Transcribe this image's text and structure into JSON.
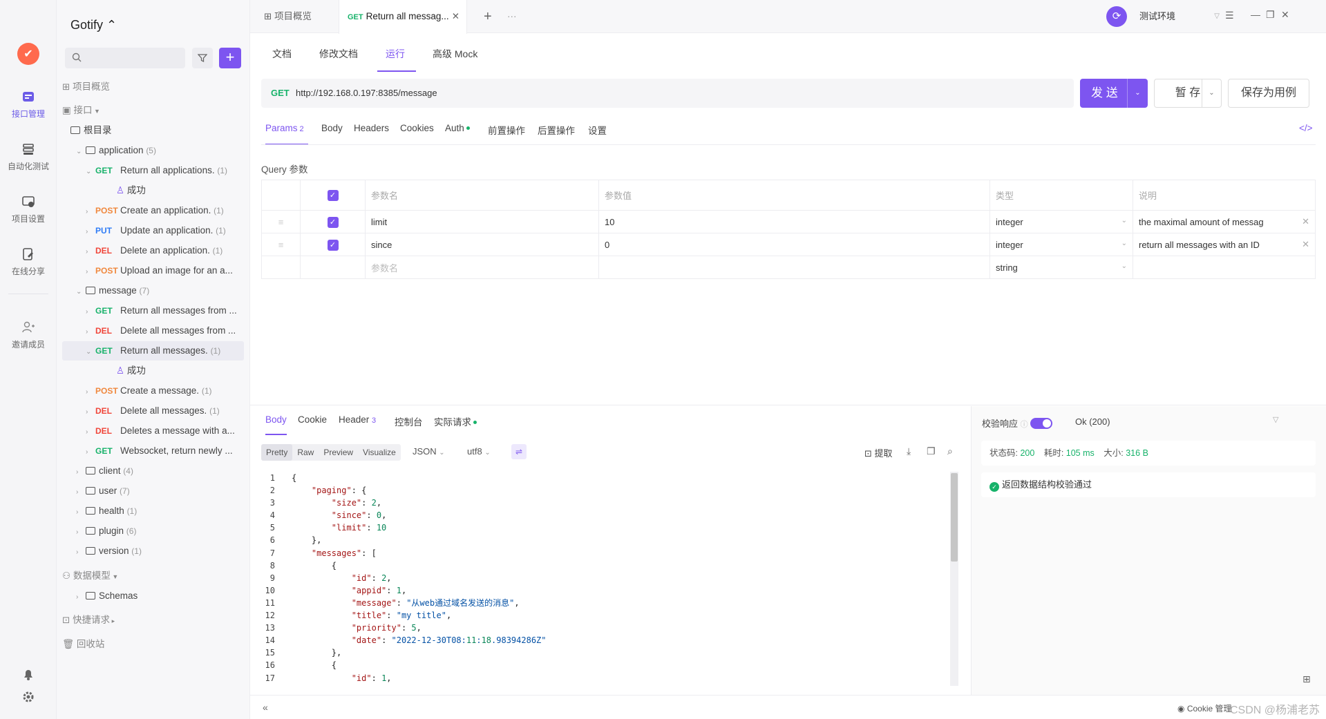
{
  "app": {
    "project": "Gotify ⌃"
  },
  "rail": {
    "items": [
      {
        "label": "接口管理"
      },
      {
        "label": "自动化测试"
      },
      {
        "label": "项目设置"
      },
      {
        "label": "在线分享"
      },
      {
        "label": "邀请成员"
      }
    ]
  },
  "tree": {
    "overview": "项目概览",
    "api_root": "接口",
    "root_dir": "根目录",
    "application": {
      "name": "application",
      "count": "(5)"
    },
    "rows": [
      {
        "method": "GET",
        "label": "Return all applications.",
        "count": "(1)"
      },
      {
        "method": "",
        "label": "成功",
        "count": ""
      },
      {
        "method": "POST",
        "label": "Create an application.",
        "count": "(1)"
      },
      {
        "method": "PUT",
        "label": "Update an application.",
        "count": "(1)"
      },
      {
        "method": "DEL",
        "label": "Delete an application.",
        "count": "(1)"
      },
      {
        "method": "POST",
        "label": "Upload an image for an a...",
        "count": ""
      }
    ],
    "message": {
      "name": "message",
      "count": "(7)"
    },
    "msg_rows": [
      {
        "method": "GET",
        "label": "Return all messages from ...",
        "count": ""
      },
      {
        "method": "DEL",
        "label": "Delete all messages from ...",
        "count": ""
      },
      {
        "method": "GET",
        "label": "Return all messages.",
        "count": "(1)"
      },
      {
        "method": "",
        "label": "成功",
        "count": ""
      },
      {
        "method": "POST",
        "label": "Create a message.",
        "count": "(1)"
      },
      {
        "method": "DEL",
        "label": "Delete all messages.",
        "count": "(1)"
      },
      {
        "method": "DEL",
        "label": "Deletes a message with a...",
        "count": ""
      },
      {
        "method": "GET",
        "label": "Websocket, return newly ...",
        "count": ""
      }
    ],
    "folders": [
      {
        "name": "client",
        "count": "(4)"
      },
      {
        "name": "user",
        "count": "(7)"
      },
      {
        "name": "health",
        "count": "(1)"
      },
      {
        "name": "plugin",
        "count": "(6)"
      },
      {
        "name": "version",
        "count": "(1)"
      }
    ],
    "data_model": "数据模型",
    "schemas": "Schemas",
    "quick": "快捷请求",
    "trash": "回收站"
  },
  "topbar": {
    "tab1": "项目概览",
    "tab2_method": "GET",
    "tab2": "Return all messag...",
    "env": "测试环境"
  },
  "subtabs": [
    "文档",
    "修改文档",
    "运行",
    "高级 Mock"
  ],
  "request": {
    "method": "GET",
    "url": "http://192.168.0.197:8385/message",
    "send": "发 送",
    "save_tmp": "暂 存",
    "save_case": "保存为用例"
  },
  "ptabs": {
    "params": "Params",
    "params_n": "2",
    "body": "Body",
    "headers": "Headers",
    "cookies": "Cookies",
    "auth": "Auth",
    "pre": "前置操作",
    "post": "后置操作",
    "settings": "设置"
  },
  "query_label": "Query 参数",
  "table": {
    "headers": [
      "参数名",
      "参数值",
      "类型",
      "说明"
    ],
    "rows": [
      {
        "name": "limit",
        "value": "10",
        "type": "integer",
        "desc": "the maximal amount of messag"
      },
      {
        "name": "since",
        "value": "0",
        "type": "integer",
        "desc": "return all messages with an ID"
      }
    ],
    "empty_name": "参数名",
    "empty_type": "string"
  },
  "response": {
    "tabs": {
      "body": "Body",
      "cookie": "Cookie",
      "header": "Header",
      "header_n": "3",
      "console": "控制台",
      "actual": "实际请求"
    },
    "views": [
      "Pretty",
      "Raw",
      "Preview",
      "Visualize"
    ],
    "format": "JSON",
    "encoding": "utf8",
    "extract": "提取",
    "validate": "校验响应",
    "status_text": "Ok (200)",
    "status_code_label": "状态码:",
    "status_code": "200",
    "time_label": "耗时:",
    "time": "105 ms",
    "size_label": "大小:",
    "size": "316 B",
    "check_msg": "返回数据结构校验通过",
    "lines": [
      "{",
      "    \"paging\": {",
      "        \"size\": 2,",
      "        \"since\": 0,",
      "        \"limit\": 10",
      "    },",
      "    \"messages\": [",
      "        {",
      "            \"id\": 2,",
      "            \"appid\": 1,",
      "            \"message\": \"从web通过域名发送的消息\",",
      "            \"title\": \"my title\",",
      "            \"priority\": 5,",
      "            \"date\": \"2022-12-30T08:11:18.98394286Z\"",
      "        },",
      "        {",
      "            \"id\": 1,"
    ]
  },
  "footer": {
    "cookie": "Cookie 管理",
    "watermark": "CSDN @杨浦老苏"
  }
}
